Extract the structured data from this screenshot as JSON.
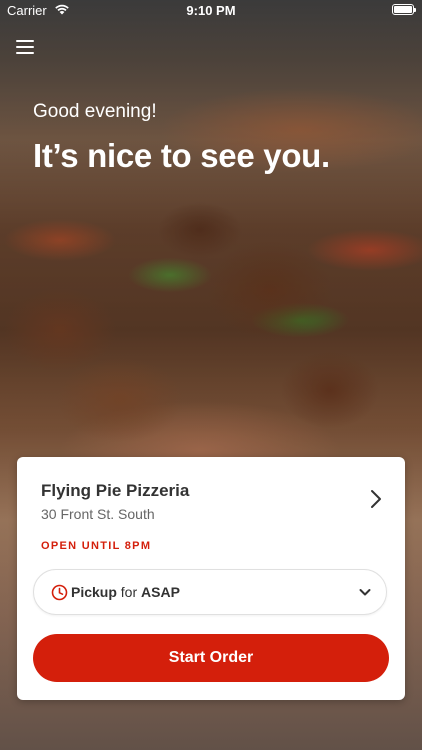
{
  "status_bar": {
    "carrier": "Carrier",
    "time": "9:10 PM"
  },
  "greeting": "Good evening!",
  "headline": "It’s nice to see you.",
  "store": {
    "name": "Flying Pie Pizzeria",
    "address": "30 Front St. South",
    "open_status": "OPEN UNTIL 8PM"
  },
  "order_mode": {
    "mode": "Pickup",
    "connector": "for",
    "time": "ASAP"
  },
  "start_button": "Start Order",
  "colors": {
    "accent": "#d41f0b",
    "card": "#ffffff",
    "text_primary": "#333333",
    "text_secondary": "#666666"
  },
  "icons": [
    "wifi-icon",
    "battery-icon",
    "menu-icon",
    "chevron-right-icon",
    "clock-icon",
    "chevron-down-icon"
  ]
}
